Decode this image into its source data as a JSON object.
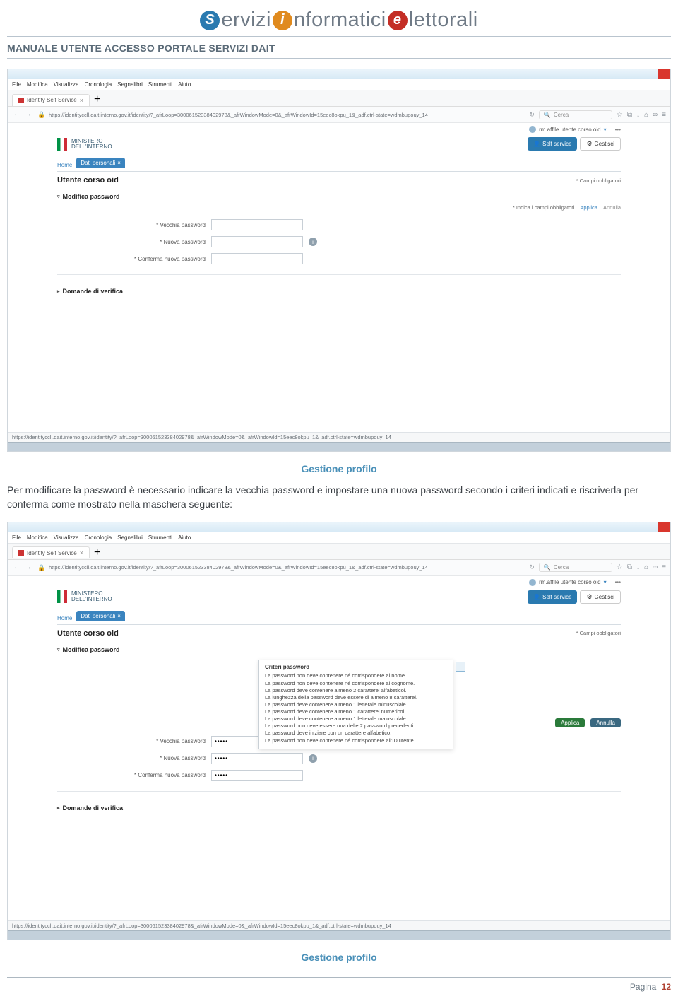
{
  "logo": {
    "part_s_letter": "S",
    "part1": "ervizi",
    "part_i_letter": "i",
    "part2": "nformatici",
    "part_e_letter": "e",
    "part3": "lettorali"
  },
  "doc_title": "MANUALE UTENTE ACCESSO PORTALE SERVIZI DAIT",
  "captions": {
    "c1": "Gestione profilo",
    "c2": "Gestione profilo"
  },
  "body_text": "Per modificare la password è necessario indicare la vecchia password e impostare una nuova password secondo i criteri indicati e riscriverla per conferma come mostrato nella maschera seguente:",
  "browser": {
    "menu": [
      "File",
      "Modifica",
      "Visualizza",
      "Cronologia",
      "Segnalibri",
      "Strumenti",
      "Aiuto"
    ],
    "tab_label": "Identity Self Service",
    "tab_close": "×",
    "url": "https://identityccll.dait.interno.gov.it/identity/?_afrLoop=30006152338402978&_afrWindowMode=0&_afrWindowId=15eec8okpu_1&_adf.ctrl-state=wdmbupouy_14",
    "search_placeholder": "Cerca",
    "reload_icon": "↻",
    "lock_icon": "🔒",
    "star_icon": "☆",
    "bookmark_icon": "⧉",
    "down_icon": "↓",
    "home_icon": "⌂",
    "clip_icon": "∞",
    "menu_icon": "≡",
    "plus_icon": "+",
    "arrow_left": "←",
    "arrow_right": "→",
    "search_icon": "🔍"
  },
  "app_common": {
    "user_text": "rm.affile utente corso oid",
    "chev": "▾",
    "dots": "•••",
    "ministry_l1": "MINISTERO",
    "ministry_l2": "DELL'INTERNO",
    "self_service": "Self service",
    "gestisci": "Gestisci",
    "gear_icon": "⚙",
    "avatar_icon": "👤",
    "home": "Home",
    "dati_tab": "Dati personali",
    "tab_close": "×",
    "title": "Utente corso oid",
    "campi_obbl": "* Campi obbligatori",
    "sect_modifica": "Modifica password",
    "sect_domande": "Domande di verifica",
    "tri_expanded": "▿",
    "tri_collapsed": "▸",
    "info_icon": "i",
    "label_vecchia": "* Vecchia password",
    "label_nuova": "* Nuova password",
    "label_conferma": "* Conferma nuova password",
    "indica_note": "* Indica i campi obbligatori",
    "applica": "Applica",
    "annulla": "Annulla"
  },
  "screenshot1": {
    "vecchia_val": "",
    "nuova_val": "",
    "conferma_val": ""
  },
  "screenshot2": {
    "vecchia_val": "•••••",
    "nuova_val": "•••••",
    "conferma_val": "•••••",
    "tooltip_title": "Criteri password",
    "tooltip_rules": [
      "La password non deve contenere né corrispondere al nome.",
      "La password non deve contenere né corrispondere al cognome.",
      "La password deve contenere almeno 2 caratterei alfabeticoi.",
      "La lunghezza della password deve essere di almeno 8 caratterei.",
      "La password deve contenere almeno 1 letterale minuscolale.",
      "La password deve contenere almeno 1 caratterei numericoi.",
      "La password deve contenere almeno 1 letterale maiuscolale.",
      "La password non deve essere una delle 2 password precedenti.",
      "La password deve iniziare con un carattere alfabetico.",
      "La password non deve contenere né corrispondere all'ID utente."
    ]
  },
  "footer": {
    "label": "Pagina",
    "num": "12"
  }
}
